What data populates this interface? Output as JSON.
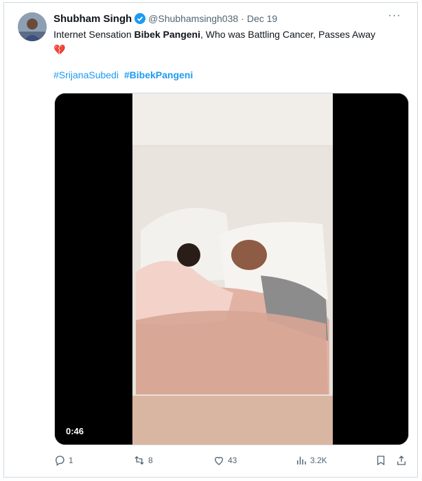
{
  "tweet": {
    "author_name": "Shubham Singh",
    "handle": "@Shubhamsingh038",
    "separator": "·",
    "date": "Dec 19",
    "more": "···",
    "text_prefix": "Internet Sensation ",
    "text_bold": "Bibek Pangeni",
    "text_suffix": ", Who was Battling Cancer, Passes Away",
    "emoji": "💔",
    "hashtags": [
      "#SrijanaSubedi",
      "#BibekPangeni"
    ],
    "video_duration": "0:46"
  },
  "actions": {
    "replies": "1",
    "retweets": "8",
    "likes": "43",
    "views": "3.2K"
  },
  "colors": {
    "link": "#1d9bf0",
    "muted": "#536471",
    "border": "#cfd9de"
  }
}
